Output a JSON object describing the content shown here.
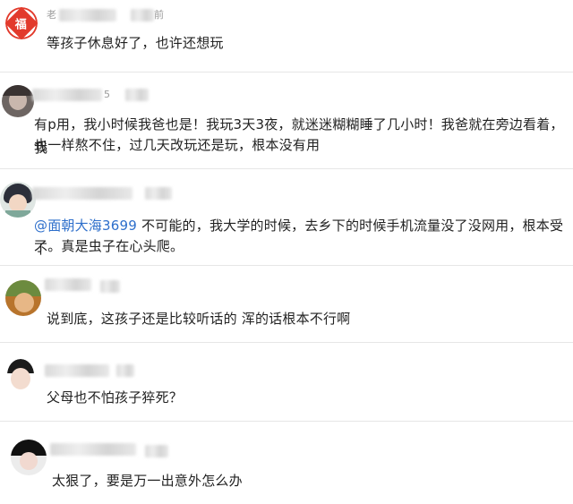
{
  "comments": [
    {
      "author_prefix": "老",
      "time_suffix": "前",
      "text": "等孩子休息好了，也许还想玩",
      "avatar_glyph": "福"
    },
    {
      "time_fragment": "5",
      "text_line1": "有p用，我小时候我爸也是！我玩3天3夜，就迷迷糊糊睡了几小时！我爸就在旁边看着，我",
      "text_line2": "也一样熬不住，过几天改玩还是玩，根本没有用"
    },
    {
      "mention": "@面朝大海3699",
      "text_line1_rest": " 不可能的，我大学的时候，去乡下的时候手机流量没了没网用，根本受不",
      "text_line2": "了。真是虫子在心头爬。"
    },
    {
      "text": "说到底，这孩子还是比较听话的 浑的话根本不行啊"
    },
    {
      "text": "父母也不怕孩子猝死？"
    },
    {
      "text": "太狠了，要是万一出意外怎么办"
    }
  ]
}
